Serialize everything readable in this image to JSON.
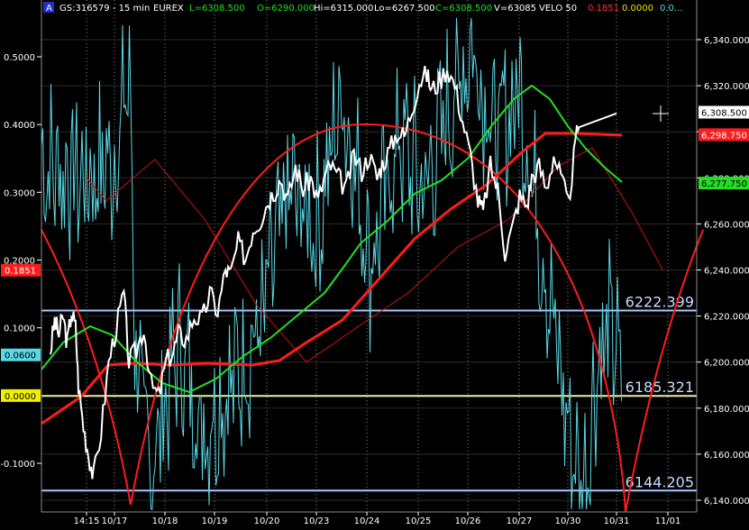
{
  "header": {
    "badge": "A",
    "symbol": "GS:316579 - 15 min",
    "exchange": "EUREX",
    "last": "L=6308.500",
    "open": "O=6290.000",
    "high": "Hi=6315.000",
    "low": "Lo=6267.500",
    "close": "C=6308.500",
    "volume": "V=63085",
    "indicator": "VELO 50",
    "ind_val1": "0.1851",
    "ind_val2": "0.0000",
    "ind_val3": "0.0..."
  },
  "colors": {
    "price": "#ffffff",
    "velo": "#5ad8e6",
    "ma_green": "#21e021",
    "ma_red": "#ff1c1c",
    "ma_thin_red": "#d01010",
    "hline": "#a8c8ff",
    "hline_yellow": "#f0f0a0",
    "grid": "#8a8a8a",
    "cursor": "#ffffff"
  },
  "chart_data": {
    "type": "line",
    "right_axis": {
      "ticks": [
        "6,340.000",
        "6,320.000",
        "6,300.000",
        "6,280.000",
        "6,260.000",
        "6,240.000",
        "6,220.000",
        "6,200.000",
        "6,180.000",
        "6,160.000",
        "6,140.000"
      ],
      "ylim": [
        6135,
        6355
      ]
    },
    "left_axis": {
      "ticks": [
        "0.5000",
        "0.4000",
        "0.3000",
        "0.2000",
        "0.1000",
        "-0.1000"
      ],
      "ylim": [
        -0.19,
        0.6
      ]
    },
    "x_labels": [
      "14:15",
      "10/17",
      "10/18",
      "10/19",
      "10/20",
      "10/23",
      "10/24",
      "10/25",
      "10/26",
      "10/27",
      "10/30",
      "10/31",
      "11/01"
    ],
    "x_index_of_labels": [
      0,
      1,
      2,
      3,
      4,
      5,
      6,
      7,
      8,
      9,
      10,
      11,
      12
    ],
    "horizontal_levels": [
      {
        "value": 6222.399,
        "label": "6222.399"
      },
      {
        "value": 6185.321,
        "label": "6185.321"
      },
      {
        "value": 6144.205,
        "label": "6144.205"
      }
    ],
    "price_tags": [
      {
        "value": 6308.5,
        "label": "6,308.500",
        "kind": "last"
      },
      {
        "value": 6298.75,
        "label": "6,298.750",
        "kind": "red_ma"
      },
      {
        "value": 6277.75,
        "label": "6,277.750",
        "kind": "green_ma"
      }
    ],
    "indicator_tags": [
      {
        "value": 0.1851,
        "label": "0.1851",
        "kind": "red"
      },
      {
        "value": 0.06,
        "label": "0.0600",
        "kind": "cyan"
      },
      {
        "value": 0.0,
        "label": "0.0000",
        "kind": "yellow"
      }
    ],
    "series": [
      {
        "values_note": "price (white), approx, x in label-index units",
        "x": [
          0,
          0.15,
          0.3,
          0.45,
          0.6,
          0.75,
          0.9,
          1.0,
          1.1,
          1.2,
          1.3,
          1.45,
          1.6,
          1.75,
          1.9,
          2.0,
          2.15,
          2.3,
          2.45,
          2.6,
          2.75,
          2.9,
          3.0,
          3.15,
          3.3,
          3.45,
          3.6,
          3.75,
          3.9,
          4.0,
          4.15,
          4.3,
          4.45,
          4.6,
          4.75,
          4.9,
          5.0,
          5.15,
          5.3,
          5.45,
          5.6,
          5.75,
          5.9,
          6.0,
          6.15,
          6.3,
          6.45,
          6.6,
          6.75,
          6.9,
          7.0,
          7.15,
          7.3,
          7.45,
          7.6,
          7.75,
          7.9,
          8.0,
          8.15,
          8.3,
          8.45,
          8.6,
          8.75,
          8.9,
          9.0,
          9.15,
          9.3,
          9.45,
          9.6,
          9.75,
          9.9,
          10.0,
          10.15,
          10.3,
          10.45,
          10.6,
          10.75,
          10.9,
          11.0
        ],
        "values": [
          6205,
          6218,
          6212,
          6220,
          6208,
          6222,
          6215,
          6190,
          6172,
          6160,
          6150,
          6170,
          6200,
          6215,
          6230,
          6200,
          6205,
          6215,
          6190,
          6185,
          6200,
          6205,
          6212,
          6210,
          6220,
          6218,
          6230,
          6222,
          6240,
          6238,
          6252,
          6245,
          6258,
          6262,
          6270,
          6275,
          6280,
          6270,
          6285,
          6275,
          6280,
          6270,
          6282,
          6285,
          6280,
          6275,
          6290,
          6283,
          6290,
          6280,
          6286,
          6292,
          6300,
          6298,
          6310,
          6322,
          6325,
          6318,
          6322,
          6328,
          6320,
          6305,
          6290,
          6270,
          6265,
          6285,
          6275,
          6248,
          6258,
          6272,
          6268,
          6280,
          6285,
          6275,
          6290,
          6280,
          6268,
          6295,
          6308
        ]
      }
    ]
  }
}
